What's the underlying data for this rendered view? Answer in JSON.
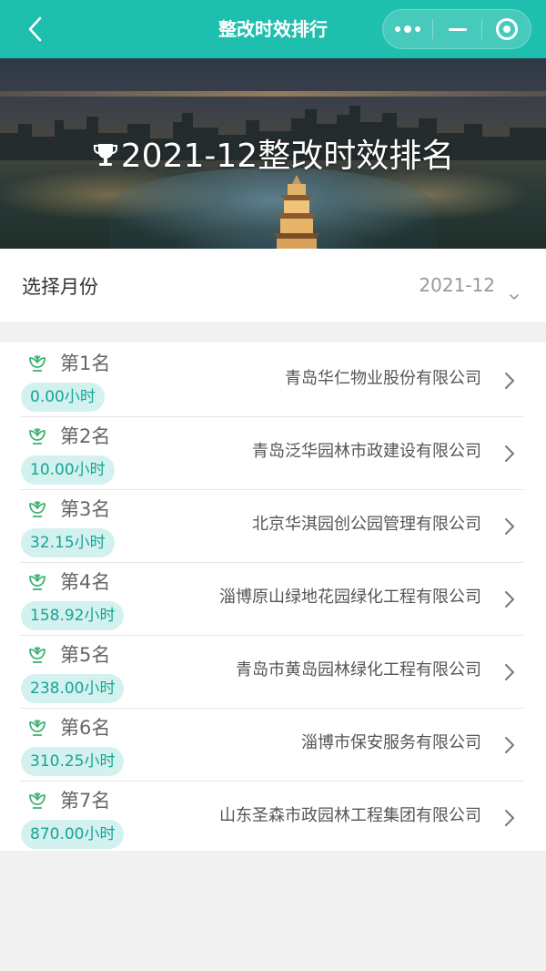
{
  "navbar": {
    "title": "整改时效排行",
    "icons": {
      "back": "chevron-left-icon",
      "more": "more-dots-icon",
      "minimize": "minimize-icon",
      "close": "target-close-icon"
    },
    "color": "#1fbfae"
  },
  "banner": {
    "title": "2021-12整改时效排名",
    "icon": "trophy-icon"
  },
  "month_selector": {
    "label": "选择月份",
    "value": "2021-12"
  },
  "ranking": [
    {
      "rank": "第1名",
      "hours": "0.00小时",
      "company": "青岛华仁物业股份有限公司"
    },
    {
      "rank": "第2名",
      "hours": "10.00小时",
      "company": "青岛泛华园林市政建设有限公司"
    },
    {
      "rank": "第3名",
      "hours": "32.15小时",
      "company": "北京华淇园创公园管理有限公司"
    },
    {
      "rank": "第4名",
      "hours": "158.92小时",
      "company": "淄博原山绿地花园绿化工程有限公司"
    },
    {
      "rank": "第5名",
      "hours": "238.00小时",
      "company": "青岛市黄岛园林绿化工程有限公司"
    },
    {
      "rank": "第6名",
      "hours": "310.25小时",
      "company": "淄博市保安服务有限公司"
    },
    {
      "rank": "第7名",
      "hours": "870.00小时",
      "company": "山东圣森市政园林工程集团有限公司"
    }
  ],
  "colors": {
    "accent": "#1fbfae",
    "badge_bg": "#d3f1ee",
    "badge_text": "#13a595",
    "rank_icon": "#3cb371"
  }
}
